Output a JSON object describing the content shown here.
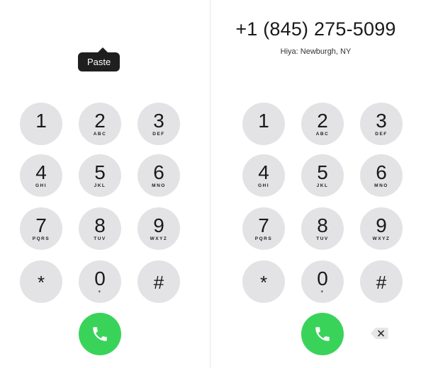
{
  "left_panel": {
    "paste_label": "Paste",
    "keys": [
      {
        "digit": "1",
        "letters": ""
      },
      {
        "digit": "2",
        "letters": "ABC"
      },
      {
        "digit": "3",
        "letters": "DEF"
      },
      {
        "digit": "4",
        "letters": "GHI"
      },
      {
        "digit": "5",
        "letters": "JKL"
      },
      {
        "digit": "6",
        "letters": "MNO"
      },
      {
        "digit": "7",
        "letters": "PQRS"
      },
      {
        "digit": "8",
        "letters": "TUV"
      },
      {
        "digit": "9",
        "letters": "WXYZ"
      },
      {
        "digit": "*",
        "letters": ""
      },
      {
        "digit": "0",
        "letters": "+"
      },
      {
        "digit": "#",
        "letters": ""
      }
    ],
    "call_icon": "phone-icon"
  },
  "right_panel": {
    "dialed_number": "+1 (845) 275-5099",
    "caller_id": "Hiya: Newburgh, NY",
    "keys": [
      {
        "digit": "1",
        "letters": ""
      },
      {
        "digit": "2",
        "letters": "ABC"
      },
      {
        "digit": "3",
        "letters": "DEF"
      },
      {
        "digit": "4",
        "letters": "GHI"
      },
      {
        "digit": "5",
        "letters": "JKL"
      },
      {
        "digit": "6",
        "letters": "MNO"
      },
      {
        "digit": "7",
        "letters": "PQRS"
      },
      {
        "digit": "8",
        "letters": "TUV"
      },
      {
        "digit": "9",
        "letters": "WXYZ"
      },
      {
        "digit": "*",
        "letters": ""
      },
      {
        "digit": "0",
        "letters": "+"
      },
      {
        "digit": "#",
        "letters": ""
      }
    ],
    "call_icon": "phone-icon",
    "delete_icon": "backspace-icon"
  },
  "colors": {
    "key_bg": "#e3e3e5",
    "call_green": "#3ad35a",
    "popover_bg": "#1f1f1f"
  }
}
